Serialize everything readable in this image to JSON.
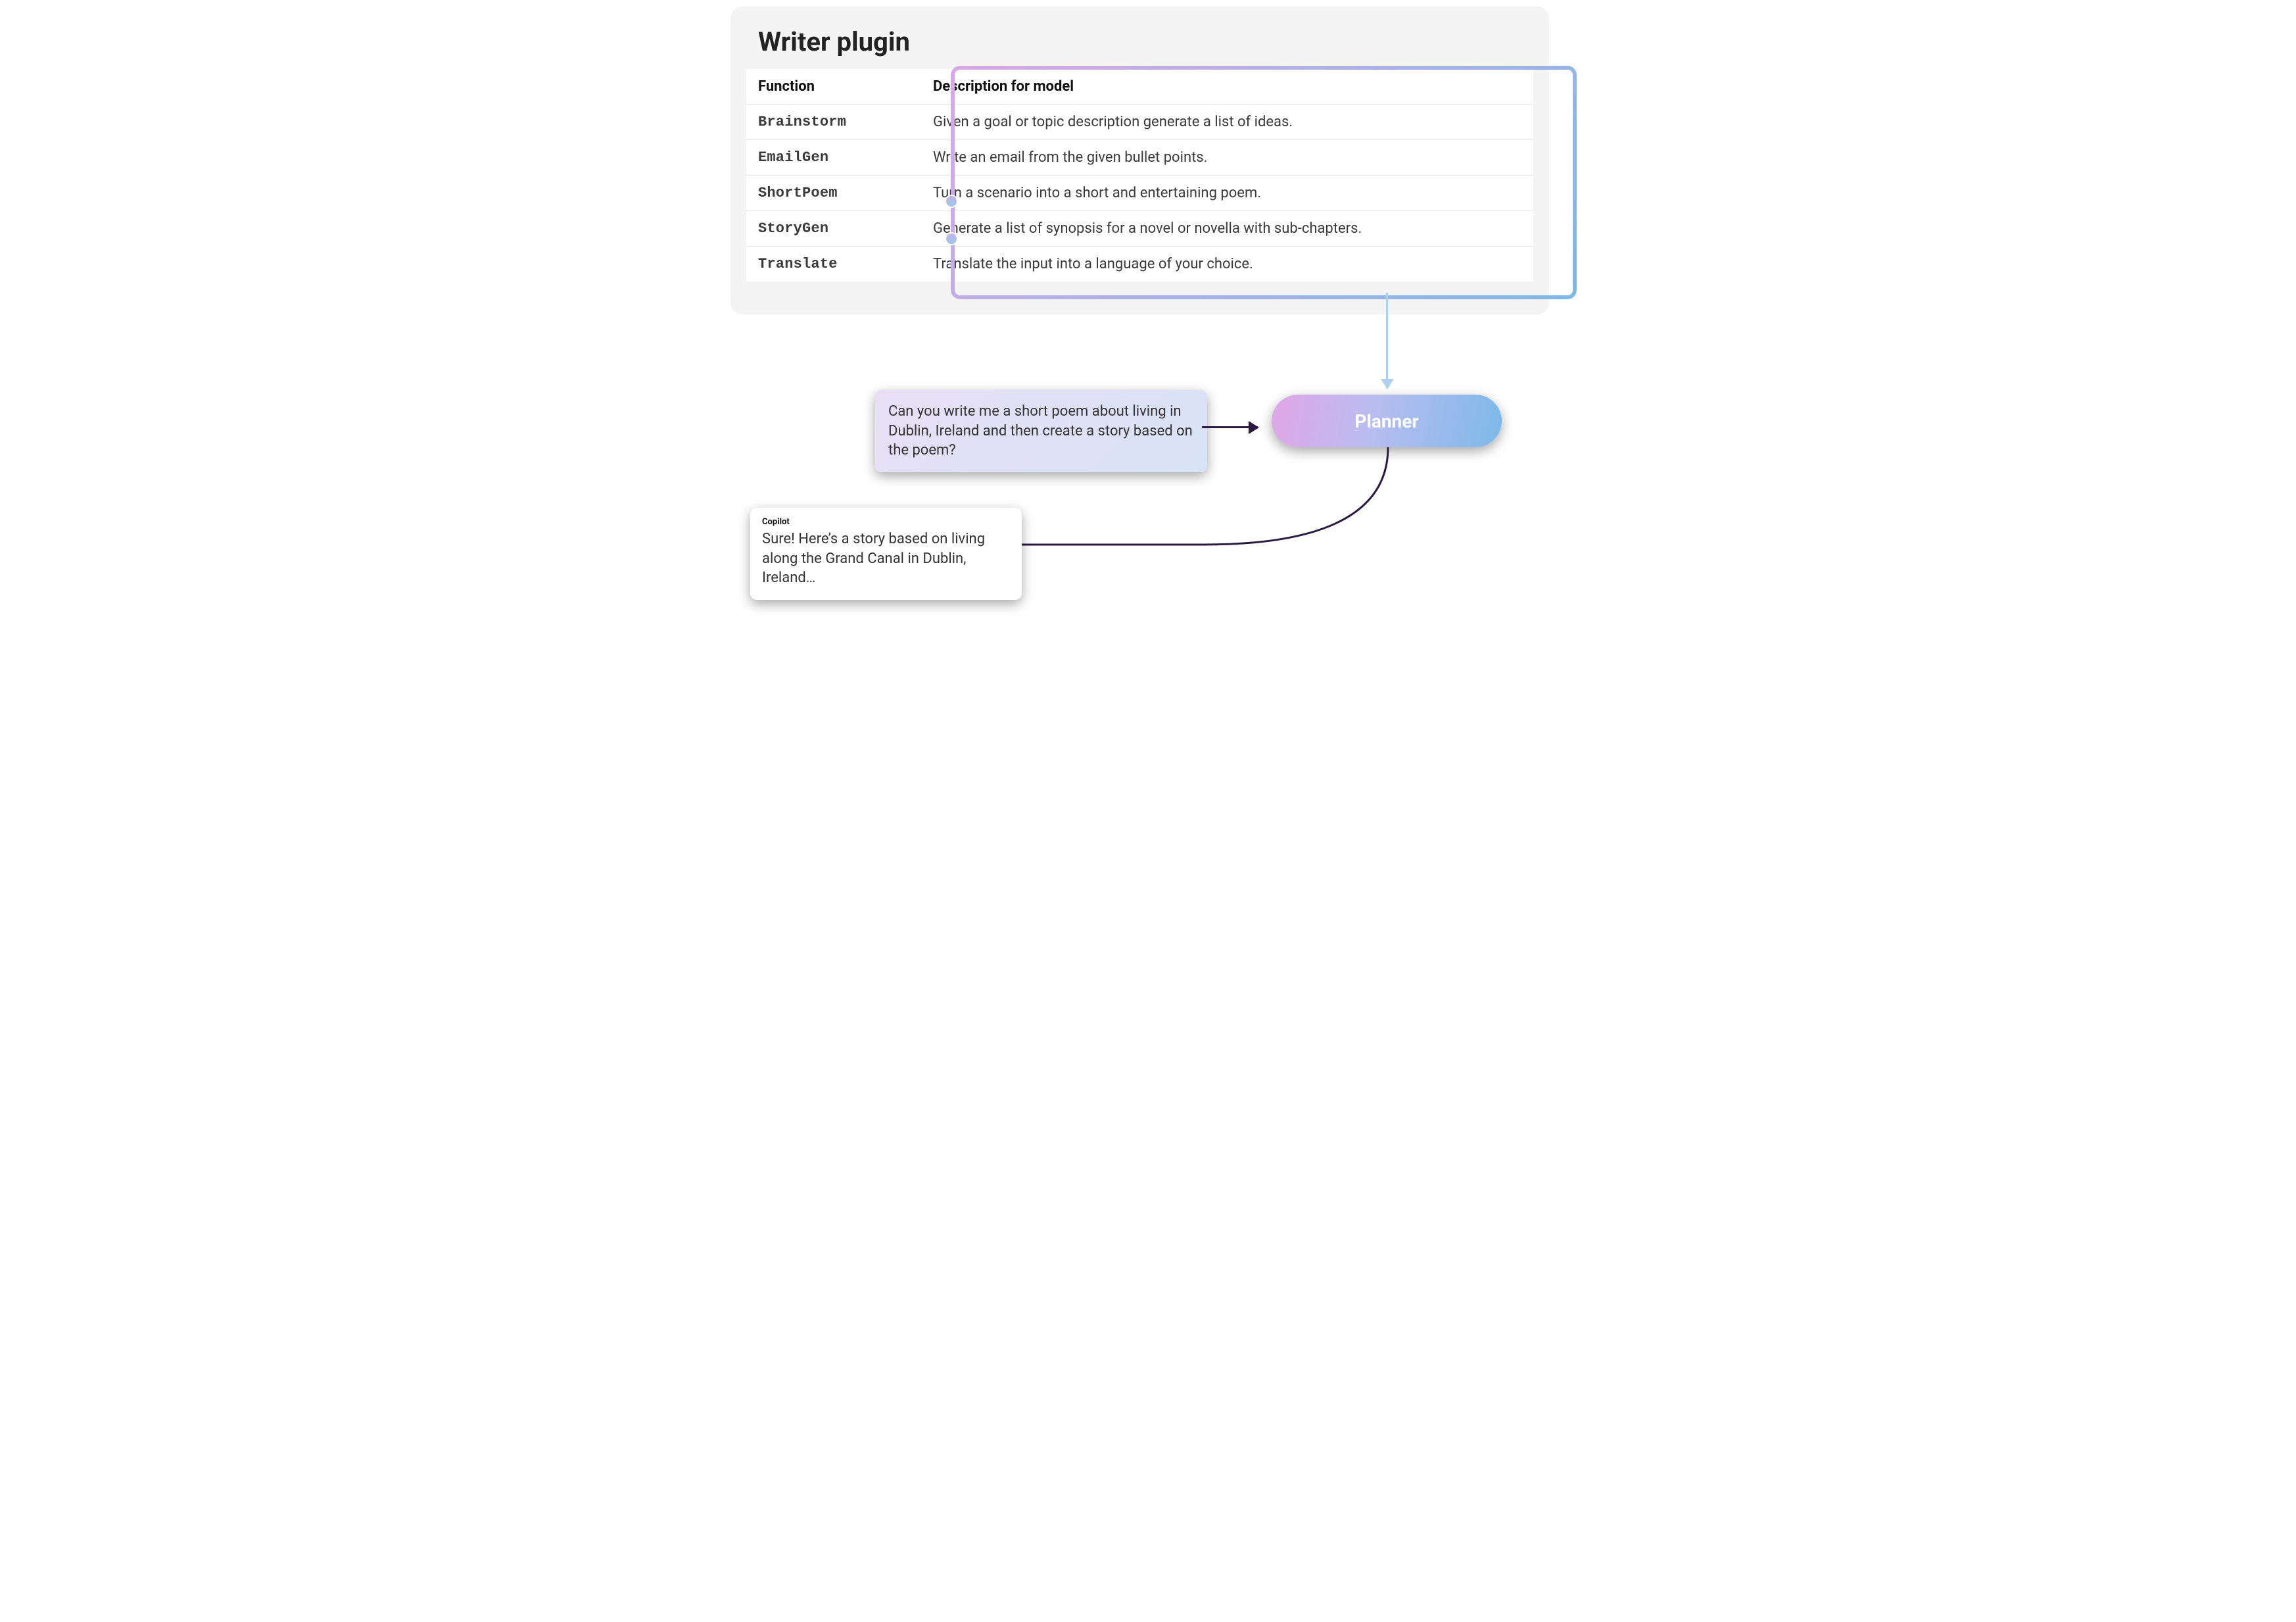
{
  "panel": {
    "title": "Writer plugin"
  },
  "table": {
    "headers": {
      "function": "Function",
      "description": "Description for model"
    },
    "rows": [
      {
        "fn": "Brainstorm",
        "desc": "Given a goal or topic description generate a list of ideas."
      },
      {
        "fn": "EmailGen",
        "desc": "Write an email from the given bullet points."
      },
      {
        "fn": "ShortPoem",
        "desc": "Turn a scenario into a short and entertaining poem."
      },
      {
        "fn": "StoryGen",
        "desc": "Generate a list of synopsis for a novel or novella with sub-chapters."
      },
      {
        "fn": "Translate",
        "desc": "Translate the input into a language of your choice."
      }
    ]
  },
  "prompt": {
    "text": "Can you write me a short poem about living in Dublin, Ireland and then create a story based on the poem?"
  },
  "planner": {
    "label": "Planner"
  },
  "response": {
    "who": "Copilot",
    "text": "Sure! Here’s a story based on living along the Grand Canal in Dublin, Ireland…"
  }
}
